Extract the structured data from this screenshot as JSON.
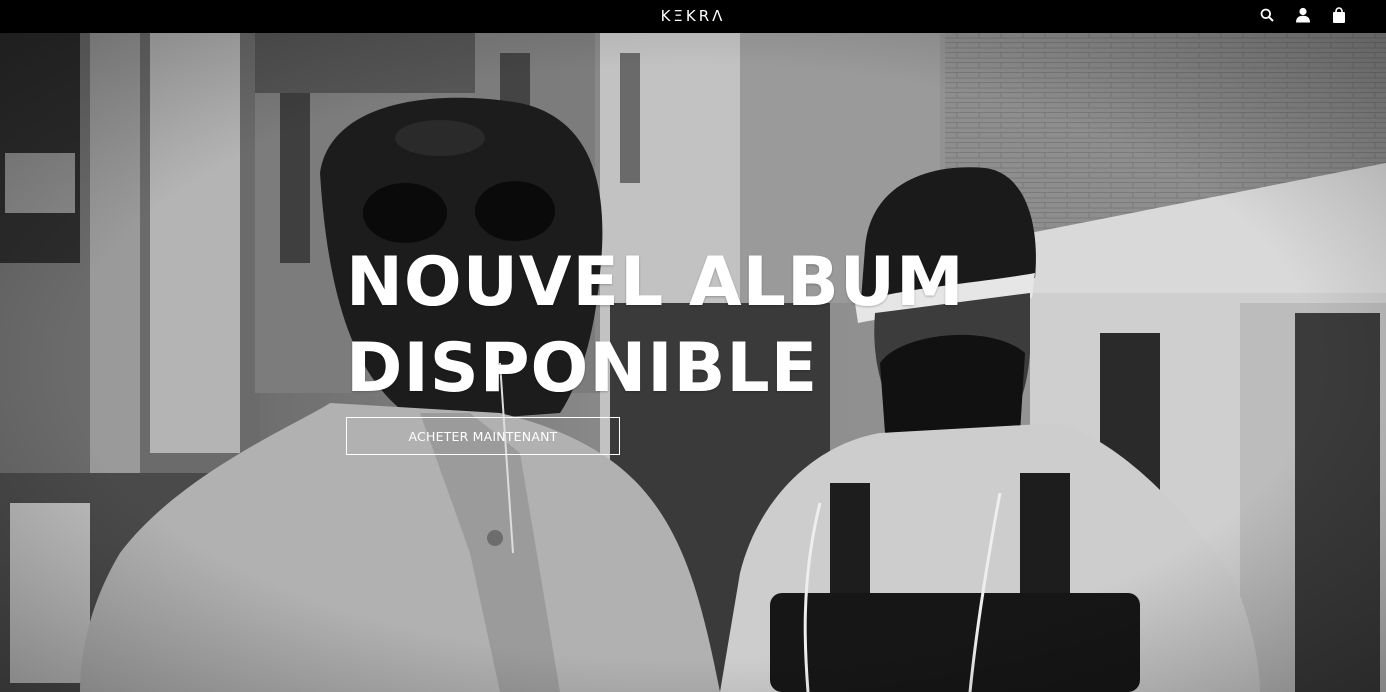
{
  "header": {
    "logo_text": "KΞKRΛ",
    "icons": [
      "search-icon",
      "account-icon",
      "cart-icon"
    ]
  },
  "hero": {
    "headline_line1": "NOUVEL ALBUM",
    "headline_line2": "DISPONIBLE",
    "cta_label": "ACHETER MAINTENANT",
    "image": "black-and-white photo of two masked artists on a street"
  },
  "colors": {
    "header_bg": "#000000",
    "text": "#ffffff"
  }
}
